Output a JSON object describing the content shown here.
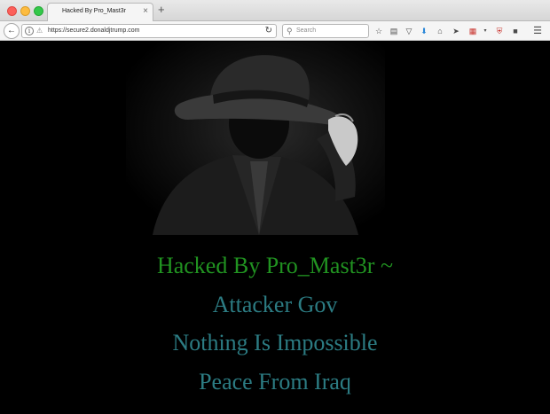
{
  "browser": {
    "tab_title": "Hacked By Pro_Mast3r",
    "tab_close": "×",
    "new_tab": "+",
    "url": "https://secure2.donaldjtrump.com",
    "search_placeholder": "Search",
    "toolbar_icons": [
      "star-icon",
      "reading-list-icon",
      "pocket-icon",
      "download-icon",
      "home-icon",
      "send-icon",
      "extension-icon",
      "shield-icon",
      "chat-icon",
      "menu-icon"
    ]
  },
  "page": {
    "hero_image": "man-in-fedora-hat-icon",
    "lines": [
      "Hacked By Pro_Mast3r ~",
      "Attacker Gov",
      "Nothing Is Impossible",
      "Peace From Iraq"
    ]
  },
  "colors": {
    "headline_green": "#219321",
    "line_teal": "#2c7c83",
    "background": "#000000"
  }
}
